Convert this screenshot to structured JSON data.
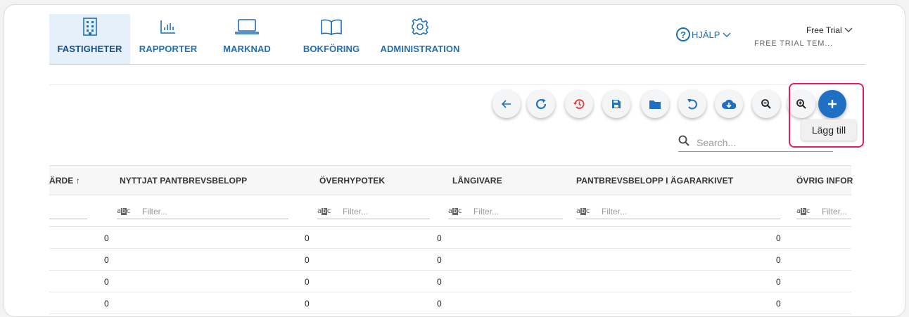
{
  "nav": {
    "items": [
      {
        "label": "FASTIGHETER",
        "icon": "building-icon"
      },
      {
        "label": "RAPPORTER",
        "icon": "bar-chart-icon"
      },
      {
        "label": "MARKNAD",
        "icon": "laptop-icon"
      },
      {
        "label": "BOKFÖRING",
        "icon": "book-icon"
      },
      {
        "label": "ADMINISTRATION",
        "icon": "gear-icon"
      }
    ],
    "active": "FASTIGHETER"
  },
  "help": {
    "label": "HJÄLP"
  },
  "account": {
    "plan": "Free Trial",
    "team": "FREE TRIAL TEM..."
  },
  "toolbar": {
    "buttons": [
      {
        "name": "back-button",
        "icon": "arrow-left-icon"
      },
      {
        "name": "refresh-button",
        "icon": "refresh-icon"
      },
      {
        "name": "history-button",
        "icon": "history-icon"
      },
      {
        "name": "save-button",
        "icon": "save-icon"
      },
      {
        "name": "folder-button",
        "icon": "folder-icon"
      },
      {
        "name": "undo-button",
        "icon": "undo-icon"
      },
      {
        "name": "download-button",
        "icon": "cloud-download-icon"
      },
      {
        "name": "zoom-out-button",
        "icon": "zoom-out-icon"
      },
      {
        "name": "zoom-in-button",
        "icon": "zoom-in-icon"
      },
      {
        "name": "add-button",
        "icon": "plus-icon"
      }
    ],
    "add_tooltip": "Lägg till"
  },
  "search": {
    "placeholder": "Search..."
  },
  "table": {
    "columns": [
      "ÄRDE ↑",
      "NYTTJAT PANTBREVSBELOPP",
      "ÖVERHYPOTEK",
      "LÅNGIVARE",
      "PANTBREVSBELOPP I ÄGARARKIVET",
      "ÖVRIG INFOR"
    ],
    "filter_badge": "abc",
    "filter_placeholder": "Filter...",
    "rows": [
      [
        "0",
        "0",
        "0",
        "",
        "0",
        ""
      ],
      [
        "0",
        "0",
        "0",
        "",
        "0",
        ""
      ],
      [
        "0",
        "0",
        "0",
        "",
        "0",
        ""
      ],
      [
        "0",
        "0",
        "0",
        "",
        "0",
        ""
      ]
    ]
  },
  "colors": {
    "accent": "#1f6fb7",
    "primary_button": "#1f6fc5",
    "highlight": "#e0205f",
    "history_icon": "#e53935"
  }
}
